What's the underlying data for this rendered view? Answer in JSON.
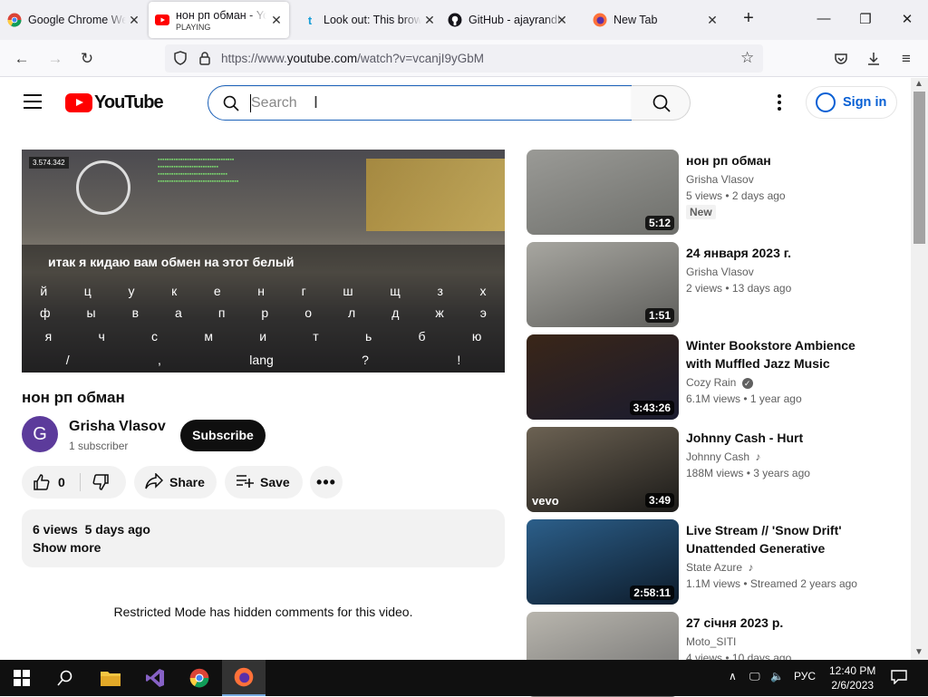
{
  "browser": {
    "tabs": [
      {
        "label": "Google Chrome We",
        "icon": "chrome-icon"
      },
      {
        "label": "нон рп обман - Yo",
        "sublabel": "PLAYING",
        "icon": "youtube-icon",
        "active": true
      },
      {
        "label": "Look out: This brow",
        "icon": "tumblr-icon"
      },
      {
        "label": "GitHub - ajayrandha",
        "icon": "github-icon"
      },
      {
        "label": "New Tab",
        "icon": "firefox-icon"
      }
    ],
    "url_prefix": "https://www.",
    "url_domain": "youtube.com",
    "url_path": "/watch?v=vcanjI9yGbM"
  },
  "header": {
    "logo_text": "YouTube",
    "search_placeholder": "Search",
    "signin_label": "Sign in"
  },
  "player": {
    "caption": "итак я кидаю вам обмен на этот белый",
    "hud_money": "3.574.342",
    "keyboard_rows": [
      [
        "й",
        "ц",
        "у",
        "к",
        "е",
        "н",
        "г",
        "ш",
        "щ",
        "з",
        "х"
      ],
      [
        "ф",
        "ы",
        "в",
        "а",
        "п",
        "р",
        "о",
        "л",
        "д",
        "ж",
        "э"
      ],
      [
        "я",
        "ч",
        "с",
        "м",
        "и",
        "т",
        "ь",
        "б",
        "ю"
      ],
      [
        "/",
        ",",
        "lang",
        "?",
        "!"
      ]
    ]
  },
  "video": {
    "title": "нон рп обман",
    "channel": "Grisha Vlasov",
    "avatar_letter": "G",
    "subscribers": "1 subscriber",
    "subscribe_label": "Subscribe",
    "likes": "0",
    "share_label": "Share",
    "save_label": "Save",
    "views": "6 views",
    "date": "5 days ago",
    "show_more": "Show more",
    "restricted_notice": "Restricted Mode has hidden comments for this video."
  },
  "recommendations": [
    {
      "title": "нон рп обман",
      "channel": "Grisha Vlasov",
      "views": "5 views",
      "age": "2 days ago",
      "duration": "5:12",
      "badge": "New",
      "thumb": [
        "#9a9a96",
        "#6e6f6b"
      ]
    },
    {
      "title": "24 января 2023 г.",
      "channel": "Grisha Vlasov",
      "views": "2 views",
      "age": "13 days ago",
      "duration": "1:51",
      "thumb": [
        "#a7a6a0",
        "#5f5f5c"
      ]
    },
    {
      "title": "Winter Bookstore Ambience with Muffled Jazz Music Playi…",
      "channel": "Cozy Rain",
      "verified": true,
      "views": "6.1M views",
      "age": "1 year ago",
      "duration": "3:43:26",
      "thumb": [
        "#3a2618",
        "#1a1b2e"
      ]
    },
    {
      "title": "Johnny Cash - Hurt",
      "channel": "Johnny Cash",
      "music": true,
      "views": "188M views",
      "age": "3 years ago",
      "duration": "3:49",
      "overlay": "vevo",
      "thumb": [
        "#6c6253",
        "#1b1a18"
      ]
    },
    {
      "title": "Live Stream // 'Snow Drift' Unattended Generative Ambie…",
      "channel": "State Azure",
      "music": true,
      "views": "1.1M views",
      "age": "Streamed 2 years ago",
      "duration": "2:58:11",
      "thumb": [
        "#2c5f8a",
        "#0d1b2a"
      ]
    },
    {
      "title": "27 січня 2023 р.",
      "channel": "Moto_SITI",
      "views": "4 views",
      "age": "10 days ago",
      "duration": "",
      "thumb": [
        "#b8b5ad",
        "#707070"
      ]
    }
  ],
  "taskbar": {
    "language": "РУС",
    "time": "12:40 PM",
    "date": "2/6/2023"
  },
  "colors": {
    "accent": "#065fd4",
    "brand": "#ff0000"
  }
}
